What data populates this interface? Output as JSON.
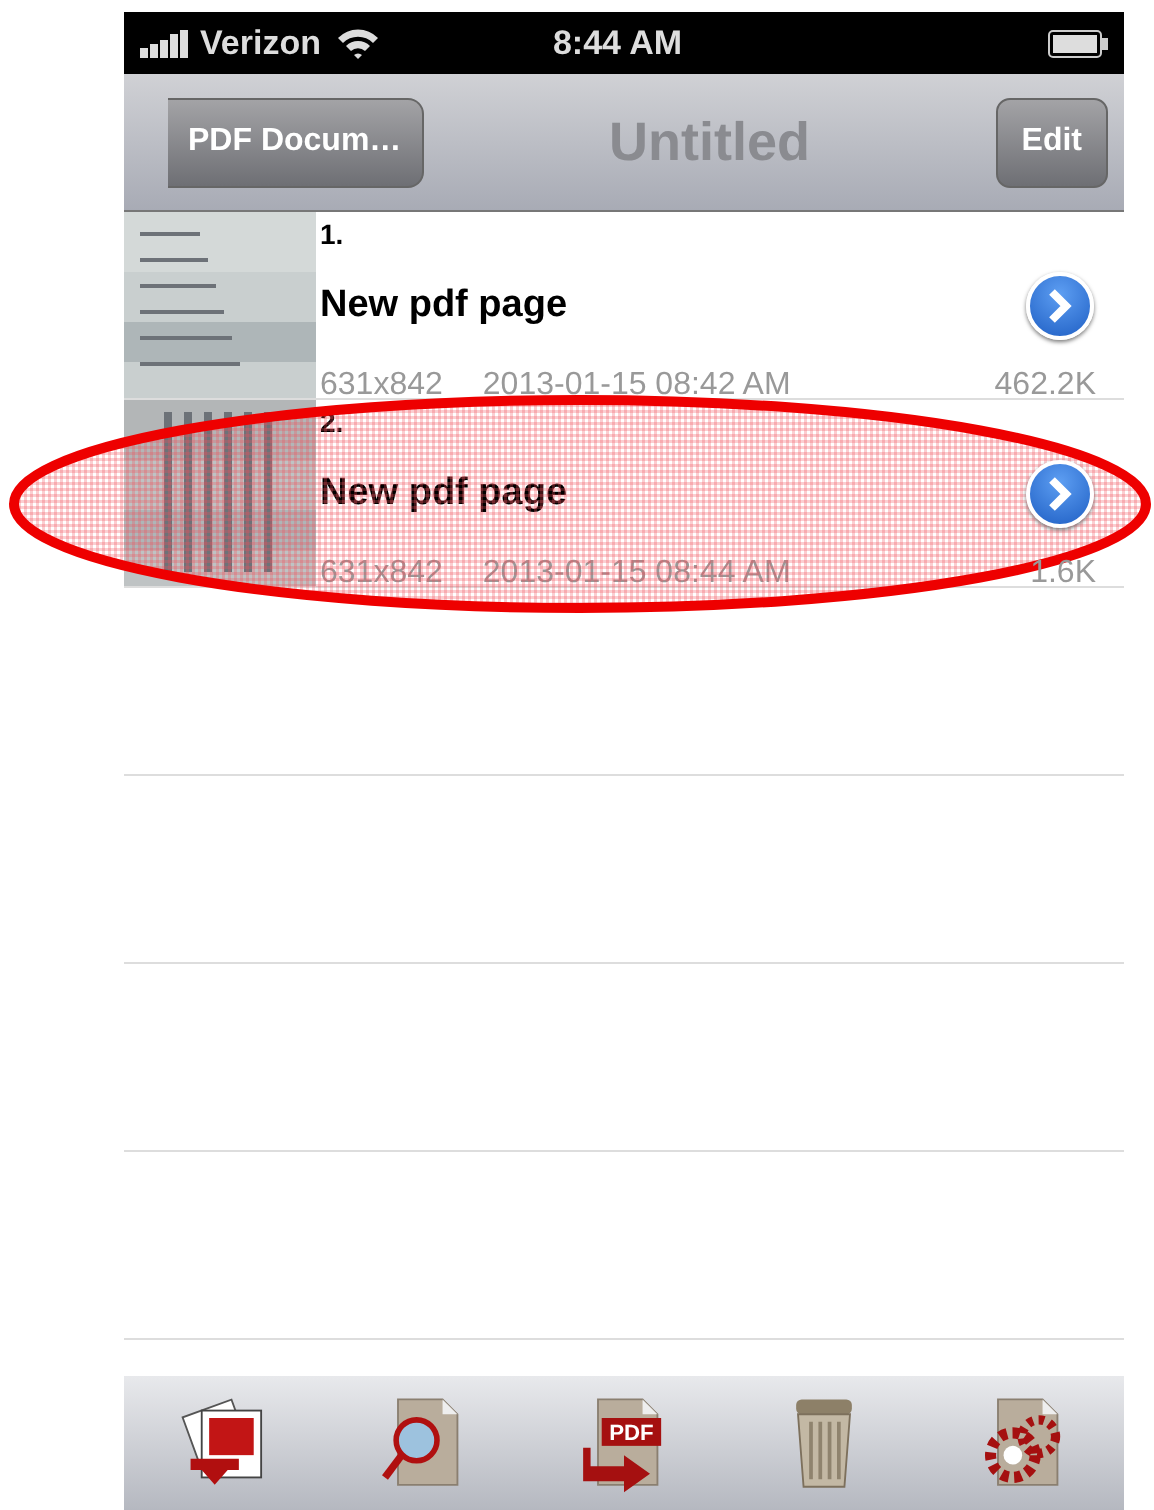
{
  "status_bar": {
    "carrier": "Verizon",
    "time": "8:44 AM"
  },
  "nav_bar": {
    "back": "PDF Docum…",
    "title": "Untitled",
    "edit": "Edit"
  },
  "pages": [
    {
      "number": "1.",
      "title": "New pdf page",
      "size": "631x842",
      "date": "2013-01-15 08:42 AM",
      "file_size": "462.2K",
      "circled": false
    },
    {
      "number": "2.",
      "title": "New pdf page",
      "size": "631x842",
      "date": "2013-01-15 08:44 AM",
      "file_size": "1.6K",
      "circled": true
    }
  ],
  "toolbar": [
    {
      "kind": "photos"
    },
    {
      "kind": "search"
    },
    {
      "kind": "pdf",
      "label": "PDF"
    },
    {
      "kind": "trash"
    },
    {
      "kind": "settings"
    }
  ]
}
